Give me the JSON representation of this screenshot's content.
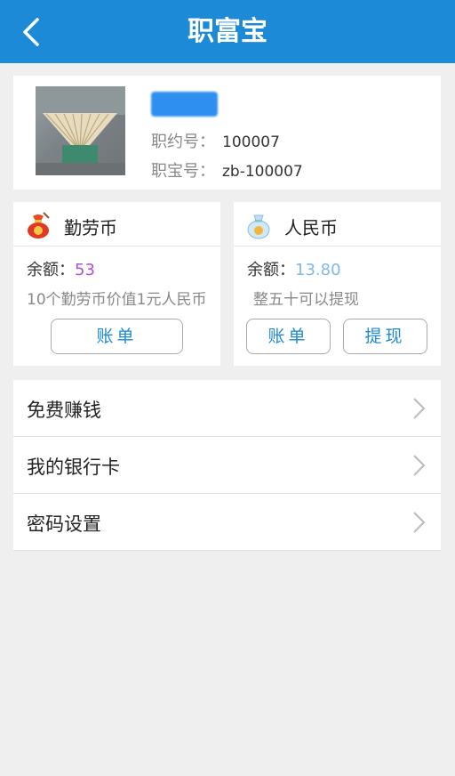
{
  "header": {
    "title": "职富宝"
  },
  "profile": {
    "id_label": "职约号：",
    "id_value": "100007",
    "bao_label": "职宝号：",
    "bao_value": "zb-100007"
  },
  "labor_coin": {
    "title": "勤劳币",
    "balance_label": "余额：",
    "balance_value": "53",
    "note": "10个勤劳币价值1元人民币",
    "bill_button": "账单",
    "balance_color": "#b34ed6"
  },
  "rmb": {
    "title": "人民币",
    "balance_label": "余额：",
    "balance_value": "13.80",
    "note": "整五十可以提现",
    "bill_button": "账单",
    "withdraw_button": "提现",
    "balance_color": "#7fb8ea"
  },
  "menu": {
    "items": [
      {
        "label": "免费赚钱"
      },
      {
        "label": "我的银行卡"
      },
      {
        "label": "密码设置"
      }
    ]
  },
  "colors": {
    "header": "#1c8ad6",
    "background": "#efefef"
  }
}
